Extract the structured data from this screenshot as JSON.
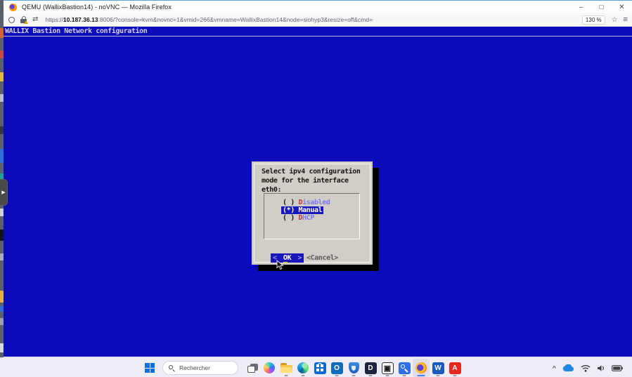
{
  "window": {
    "title": "QEMU (WallixBastion14) - noVNC — Mozilla Firefox",
    "controls": {
      "minimize": "–",
      "maximize": "□",
      "close": "✕"
    }
  },
  "toolbar": {
    "url": {
      "scheme": "https://",
      "host": "10.187.36.13",
      "rest": ":8006/?console=kvm&novnc=1&vmid=266&vmname=WallixBastion14&node=siohyp3&resize=off&cmd="
    },
    "zoom_level": "130 %",
    "star_glyph": "☆",
    "menu_glyph": "≡",
    "arrows_glyph": "⇄",
    "icons": [
      "tracking-protection-shield",
      "insecure-lock-warning",
      "connection-arrows",
      "bookmark-star",
      "app-menu"
    ]
  },
  "vnc": {
    "header": "WALLIX Bastion Network configuration",
    "handle_glyph": "▶",
    "dialog": {
      "prompt": [
        "Select ipv4 configuration",
        "mode for the interface",
        "eth0:"
      ],
      "options": [
        {
          "radio": "( ) ",
          "hotkey": "D",
          "rest": "isabled",
          "selected": false
        },
        {
          "radio": "(*) ",
          "hotkey": "M",
          "rest": "anual",
          "selected": true
        },
        {
          "radio": "( ) ",
          "hotkey": "D",
          "rest": "HCP",
          "selected": false
        }
      ],
      "ok": {
        "left": "<",
        "label_first": "O",
        "label_rest": "K",
        "right": ">"
      },
      "cancel_label": "<Cancel>"
    },
    "colors": {
      "background": "#0b0bbb",
      "dialog_background": "#d1cec7",
      "selection_blue": "#1717bd",
      "hotkey_red": "#c0392f",
      "option_blue": "#7a7af0",
      "cursor_yellow": "#d8d23c",
      "header_text": "#d2d2ee"
    }
  },
  "taskbar": {
    "search_placeholder": "Rechercher",
    "app_icons": [
      "windows-start",
      "search",
      "task-view",
      "copilot",
      "file-explorer",
      "edge",
      "microsoft-store",
      "outlook",
      "security-shield-app",
      "d-app",
      "cube-app",
      "key-app",
      "firefox",
      "word",
      "acrobat"
    ],
    "app_glyphs": {
      "outlook": "O",
      "d_app": "D",
      "cube_app": "▣",
      "word": "W",
      "acrobat": "A"
    },
    "tray_icons": [
      "tray-expand-chevron",
      "onedrive-cloud",
      "wifi",
      "volume",
      "battery"
    ],
    "tray_chevron_glyph": "^"
  }
}
